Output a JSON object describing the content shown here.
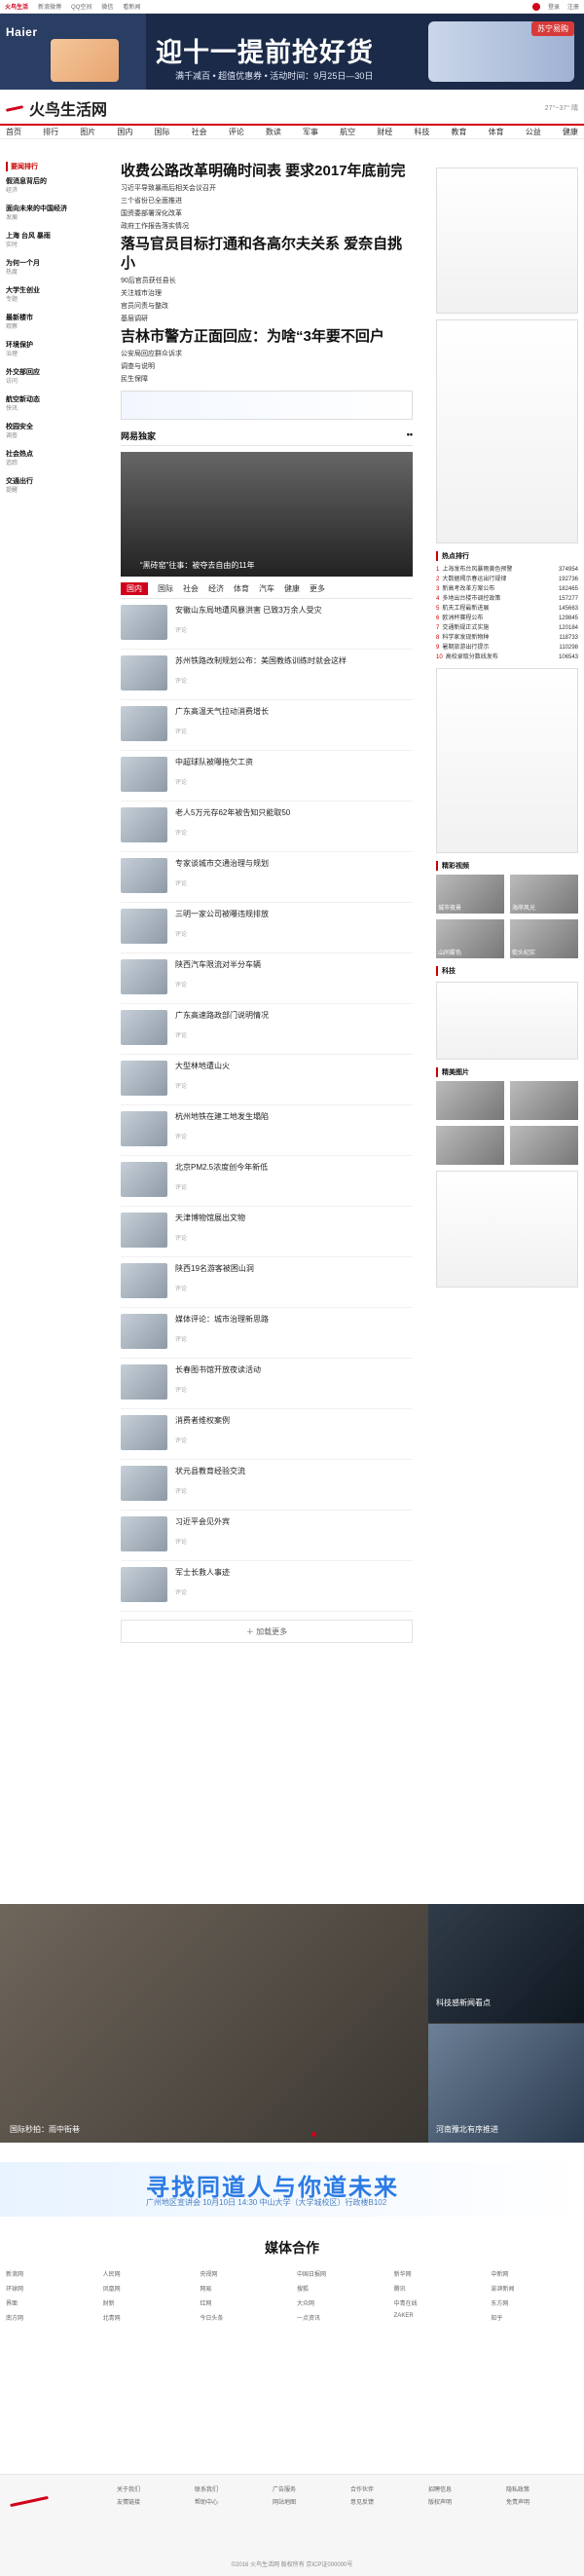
{
  "topbar": {
    "brand": "火鸟生活",
    "items": [
      "新浪微博",
      "QQ空间",
      "微信",
      "看新闻"
    ],
    "right": [
      "登录",
      "注册"
    ]
  },
  "banner": {
    "logo": "Haier",
    "title": "迎十一提前抢好货",
    "subtitle": "满千减百 • 超值优惠券 • 活动时间：9月25日—30日",
    "badge": "苏宁易购"
  },
  "site": {
    "name": "火鸟生活网",
    "weather": "27°~37° 晴"
  },
  "nav": {
    "items": [
      "首页",
      "排行",
      "图片",
      "国内",
      "国际",
      "社会",
      "评论",
      "数读",
      "军事",
      "航空",
      "财经",
      "科技",
      "教育",
      "体育",
      "公益",
      "健康"
    ]
  },
  "left": {
    "section": "要闻排行",
    "items": [
      {
        "h": "假消息背后的",
        "s": "经济"
      },
      {
        "h": "面向未来的中国经济",
        "s": "发展"
      },
      {
        "h": "上海 台风 暴雨",
        "s": "实时"
      },
      {
        "h": "为何一个月",
        "s": "热度"
      },
      {
        "h": "大学生创业",
        "s": "专题"
      },
      {
        "h": "最新楼市",
        "s": "观察"
      },
      {
        "h": "环境保护",
        "s": "治理"
      },
      {
        "h": "外交部回应",
        "s": "访问"
      },
      {
        "h": "航空新动态",
        "s": "快讯"
      },
      {
        "h": "校园安全",
        "s": "调查"
      },
      {
        "h": "社会热点",
        "s": "追踪"
      },
      {
        "h": "交通出行",
        "s": "提醒"
      }
    ]
  },
  "main": {
    "headlines": [
      {
        "title": "收费公路改革明确时间表 要求2017年底前完",
        "subs": [
          "习近平导致暴雨后相关会议召开",
          "三个省份已全面推进",
          "国资委部署深化改革",
          "政府工作报告落实情况"
        ]
      },
      {
        "title": "落马官员目标打通和各高尔夫关系 爱奈自挑小",
        "subs": [
          "90后官员获任县长",
          "关注城市治理",
          "官员问责与整改",
          "基层调研"
        ]
      },
      {
        "title": "吉林市警方正面回应：为啥“3年要不回户",
        "subs": [
          "公安局回应群众诉求",
          "调查与说明",
          "民生保障"
        ]
      }
    ],
    "featured_section": "网易独家",
    "featured_caption": "“黑砖窑”往事：被夺去自由的11年",
    "tabs": [
      "国内",
      "国际",
      "社会",
      "经济",
      "体育",
      "汽车",
      "健康",
      "更多"
    ],
    "feed": [
      {
        "t": "安徽山东局地遭风暴洪害 已致3万余人受灾",
        "m": "评论"
      },
      {
        "t": "苏州铁路改制规划公布：美国教练训练时就会这样",
        "m": "评论"
      },
      {
        "t": "广东高温天气拉动消费增长",
        "m": "评论"
      },
      {
        "t": "中超球队被曝拖欠工资",
        "m": "评论"
      },
      {
        "t": "老人5万元存62年被告知只能取50",
        "m": "评论"
      },
      {
        "t": "专家谈城市交通治理与规划",
        "m": "评论"
      },
      {
        "t": "三明一家公司被曝违规排放",
        "m": "评论"
      },
      {
        "t": "陕西汽车限流对半分车辆",
        "m": "评论"
      },
      {
        "t": "广东高速路政部门说明情况",
        "m": "评论"
      },
      {
        "t": "大型林地遭山火",
        "m": "评论"
      },
      {
        "t": "杭州地铁在建工地发生塌陷",
        "m": "评论"
      },
      {
        "t": "北京PM2.5浓度创今年新低",
        "m": "评论"
      },
      {
        "t": "天津博物馆展出文物",
        "m": "评论"
      },
      {
        "t": "陕西19名游客被困山洞",
        "m": "评论"
      },
      {
        "t": "媒体评论：城市治理新思路",
        "m": "评论"
      },
      {
        "t": "长春图书馆开放夜读活动",
        "m": "评论"
      },
      {
        "t": "消费者维权案例",
        "m": "评论"
      },
      {
        "t": "状元县教育经验交流",
        "m": "评论"
      },
      {
        "t": "习近平会见外宾",
        "m": "评论"
      },
      {
        "t": "军士长救人事迹",
        "m": "评论"
      }
    ],
    "load_more": "加载更多"
  },
  "right": {
    "hot_title": "热点排行",
    "hot": [
      {
        "n": "1",
        "t": "上海发布台风暴雨黄色预警",
        "c": "374954"
      },
      {
        "n": "2",
        "t": "大数据揭示春运出行规律",
        "c": "192736"
      },
      {
        "n": "3",
        "t": "新高考改革方案公布",
        "c": "182465"
      },
      {
        "n": "4",
        "t": "多地出台楼市调控政策",
        "c": "157277"
      },
      {
        "n": "5",
        "t": "航天工程最新进展",
        "c": "145663"
      },
      {
        "n": "6",
        "t": "欧洲杯赛程公布",
        "c": "129845"
      },
      {
        "n": "7",
        "t": "交通新规正式实施",
        "c": "120184"
      },
      {
        "n": "8",
        "t": "科学家发现新物种",
        "c": "118733"
      },
      {
        "n": "9",
        "t": "暑期旅游出行提示",
        "c": "110298"
      },
      {
        "n": "10",
        "t": "高校录取分数线发布",
        "c": "106543"
      }
    ],
    "gallery_title": "精彩视频",
    "gallery": [
      {
        "c": "城市夜景"
      },
      {
        "c": "海岸风光"
      },
      {
        "c": "山间雾色"
      },
      {
        "c": "街头纪实"
      }
    ],
    "tech_title": "科技",
    "beauty_title": "精美图片"
  },
  "photos": {
    "big_caption": "国际秒拍：雨中街巷",
    "right_top_caption": "科技感新闻看点",
    "right_bottom_caption": "河南豫北有序推进"
  },
  "campaign": {
    "title": "寻找同道人与你道未来",
    "subtitle": "广州地区宣讲会 10月10日 14:30 中山大学（大学城校区）行政楼B102"
  },
  "partners": {
    "title": "媒体合作",
    "items": [
      "新浪网",
      "人民网",
      "央视网",
      "中国日报网",
      "新华网",
      "中新网",
      "环球网",
      "凤凰网",
      "网易",
      "搜狐",
      "腾讯",
      "澎湃新闻",
      "界面",
      "财新",
      "红网",
      "大众网",
      "中青在线",
      "东方网",
      "南方网",
      "北青网",
      "今日头条",
      "一点资讯",
      "ZAKER",
      "知乎"
    ]
  },
  "footer": {
    "links": [
      "关于我们",
      "联系我们",
      "广告服务",
      "合作伙伴",
      "招聘信息",
      "隐私政策",
      "友情链接",
      "帮助中心",
      "网站地图",
      "意见反馈",
      "版权声明",
      "免责声明"
    ],
    "copyright": "©2016 火鸟生活网 版权所有 京ICP证000000号"
  },
  "colors": {
    "accent": "#d0021b",
    "primary_text": "#111111"
  }
}
